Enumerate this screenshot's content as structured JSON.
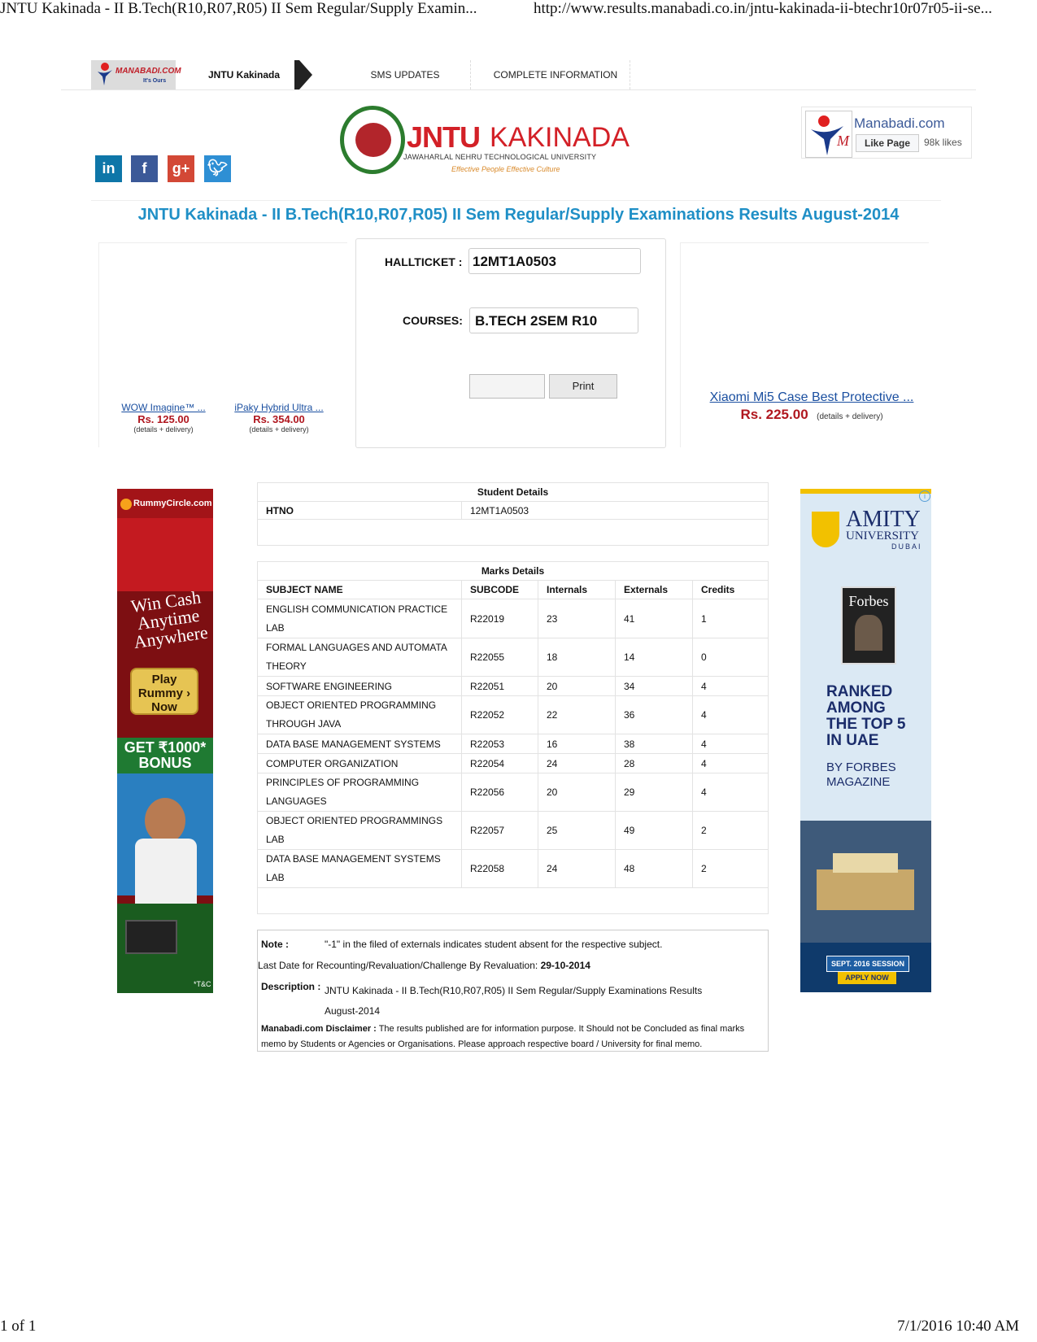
{
  "print": {
    "page_title": "JNTU Kakinada - II B.Tech(R10,R07,R05) II Sem Regular/Supply Examin...",
    "url": "http://www.results.manabadi.co.in/jntu-kakinada-ii-btechr10r07r05-ii-se...",
    "page_count": "1 of 1",
    "datetime": "7/1/2016 10:40 AM"
  },
  "nav": {
    "logo_text": "MANABADI.COM",
    "logo_tag": "It's Ours",
    "items": [
      "JNTU Kakinada",
      "SMS UPDATES",
      "COMPLETE INFORMATION"
    ]
  },
  "social": [
    {
      "icon": "linkedin-icon",
      "glyph": "in",
      "color": "#0e76a8"
    },
    {
      "icon": "facebook-icon",
      "glyph": "f",
      "color": "#3b5998"
    },
    {
      "icon": "google-plus-icon",
      "glyph": "g+",
      "color": "#d34836"
    },
    {
      "icon": "twitter-icon",
      "glyph": "t",
      "color": "#2e8fd4"
    }
  ],
  "logo": {
    "word1": "JNTU",
    "word2": "KAKINADA",
    "subtitle": "JAWAHARLAL NEHRU TECHNOLOGICAL UNIVERSITY",
    "tagline": "Effective People Effective Culture"
  },
  "fb_widget": {
    "name": "Manabadi.com",
    "like_label": "Like Page",
    "likes": "98k likes"
  },
  "page_title": "JNTU Kakinada - II B.Tech(R10,R07,R05) II Sem Regular/Supply Examinations Results August-2014",
  "form": {
    "hallticket_label": "HALLTICKET :",
    "hallticket_value": "12MT1A0503",
    "courses_label": "COURSES:",
    "courses_value": "B.TECH 2SEM R10",
    "print_label": "Print"
  },
  "ads": {
    "left_products": [
      {
        "name": "WOW Imagine™ ...",
        "price": "Rs. 125.00",
        "details": "(details + delivery)"
      },
      {
        "name": "iPaky Hybrid Ultra ...",
        "price": "Rs. 354.00",
        "details": "(details + delivery)"
      }
    ],
    "right_product": {
      "name": "Xiaomi Mi5 Case Best Protective ...",
      "price": "Rs. 225.00",
      "details": "(details + delivery)"
    },
    "rummy": {
      "brand": "RummyCircle.com",
      "headline": [
        "Win Cash",
        "Anytime",
        "Anywhere"
      ],
      "cta": [
        "Play",
        "Rummy ›",
        "Now"
      ],
      "bonus": [
        "GET ₹1000*",
        "BONUS"
      ],
      "tc": "*T&C"
    },
    "amity": {
      "brand1": "AMITY",
      "brand2": "UNIVERSITY",
      "brand3": "DUBAI",
      "magazine": "Forbes",
      "ranked": [
        "RANKED",
        "AMONG",
        "THE TOP 5",
        "IN UAE"
      ],
      "by": [
        "BY FORBES",
        "MAGAZINE"
      ],
      "session": "SEPT. 2016 SESSION",
      "apply": "APPLY NOW"
    }
  },
  "student": {
    "header": "Student Details",
    "htno_label": "HTNO",
    "htno_value": "12MT1A0503"
  },
  "marks": {
    "header": "Marks Details",
    "columns": [
      "SUBJECT NAME",
      "SUBCODE",
      "Internals",
      "Externals",
      "Credits"
    ],
    "rows": [
      [
        "ENGLISH COMMUNICATION PRACTICE LAB",
        "R22019",
        "23",
        "41",
        "1"
      ],
      [
        "FORMAL LANGUAGES AND AUTOMATA THEORY",
        "R22055",
        "18",
        "14",
        "0"
      ],
      [
        "SOFTWARE ENGINEERING",
        "R22051",
        "20",
        "34",
        "4"
      ],
      [
        "OBJECT ORIENTED PROGRAMMING THROUGH JAVA",
        "R22052",
        "22",
        "36",
        "4"
      ],
      [
        "DATA BASE MANAGEMENT SYSTEMS",
        "R22053",
        "16",
        "38",
        "4"
      ],
      [
        "COMPUTER ORGANIZATION",
        "R22054",
        "24",
        "28",
        "4"
      ],
      [
        "PRINCIPLES OF PROGRAMMING LANGUAGES",
        "R22056",
        "20",
        "29",
        "4"
      ],
      [
        "OBJECT ORIENTED PROGRAMMINGS LAB",
        "R22057",
        "25",
        "49",
        "2"
      ],
      [
        "DATA BASE MANAGEMENT SYSTEMS LAB",
        "R22058",
        "24",
        "48",
        "2"
      ]
    ]
  },
  "note": {
    "note_label": "Note :",
    "note_text": "\"-1\" in the filed of externals indicates student absent for the respective subject.",
    "last_date_label": "Last Date for Recounting/Revaluation/Challenge By Revaluation:",
    "last_date_value": "29-10-2014",
    "description_label": "Description :",
    "description_text": "JNTU Kakinada - II B.Tech(R10,R07,R05) II Sem Regular/Supply Examinations Results August-2014",
    "disclaimer_label": "Manabadi.com Disclaimer :",
    "disclaimer_text": "The results published are for information purpose. It Should not be Concluded as final marks memo by Students or Agencies or Organisations. Please approach respective board / University for final memo."
  }
}
